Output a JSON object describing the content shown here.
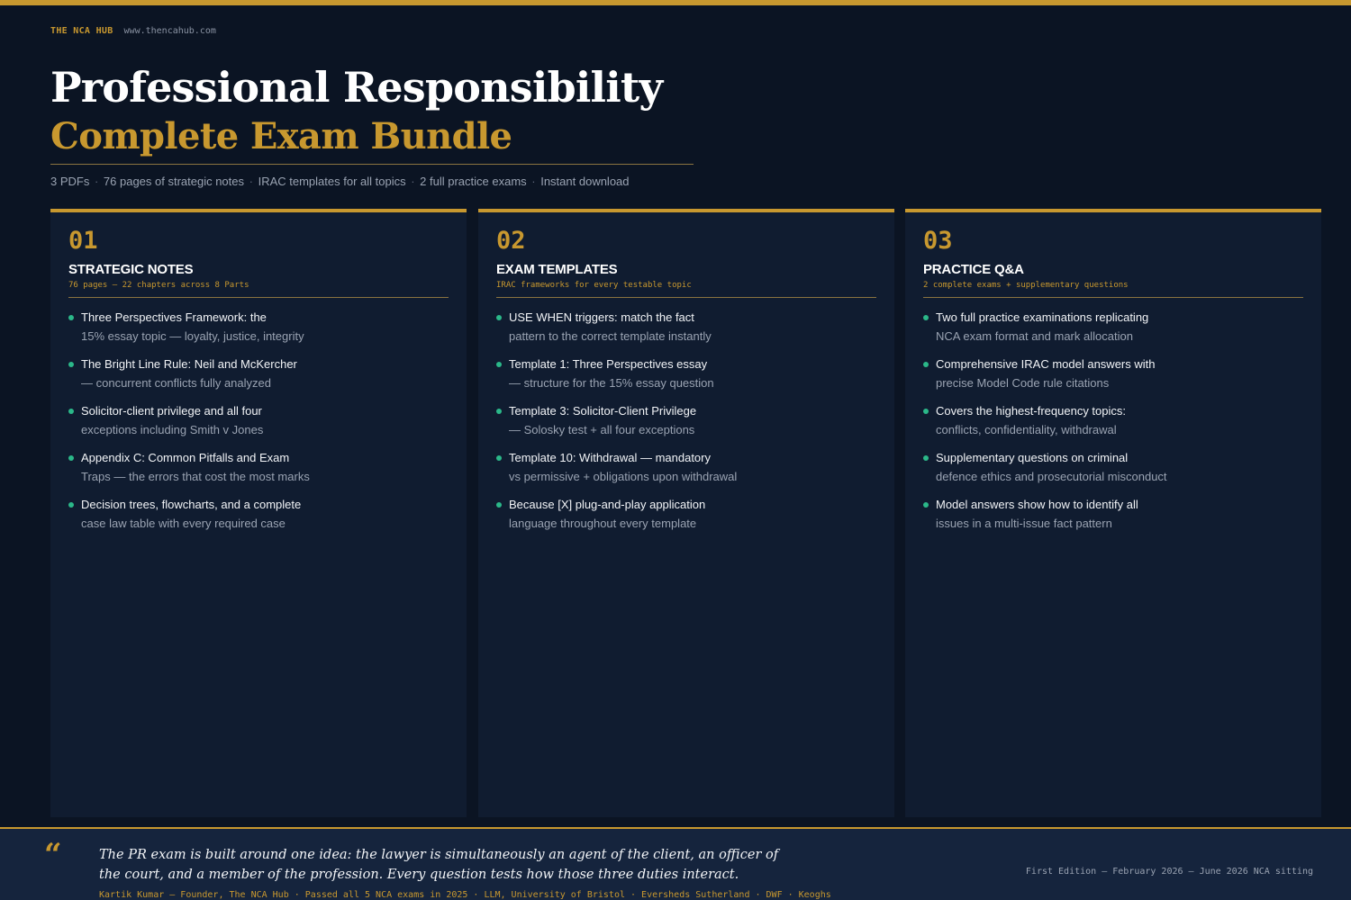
{
  "brand": {
    "name": "THE NCA HUB",
    "url": "www.thencahub.com"
  },
  "header": {
    "title": "Professional Responsibility",
    "subtitle": "Complete Exam Bundle",
    "meta": [
      "3 PDFs",
      "76 pages of strategic notes",
      "IRAC templates for all topics",
      "2 full practice exams",
      "Instant download"
    ],
    "meta_separator": "·"
  },
  "cards": [
    {
      "number": "01",
      "title": "STRATEGIC NOTES",
      "subtitle": "76 pages — 22 chapters across 8 Parts",
      "items": [
        {
          "line1": "Three Perspectives Framework: the",
          "line2": "15% essay topic — loyalty, justice, integrity"
        },
        {
          "line1": "The Bright Line Rule: Neil and McKercher",
          "line2": "— concurrent conflicts fully analyzed"
        },
        {
          "line1": "Solicitor-client privilege and all four",
          "line2": "exceptions including Smith v Jones"
        },
        {
          "line1": "Appendix C: Common Pitfalls and Exam",
          "line2": "Traps — the errors that cost the most marks"
        },
        {
          "line1": "Decision trees, flowcharts, and a complete",
          "line2": "case law table with every required case"
        }
      ]
    },
    {
      "number": "02",
      "title": "EXAM TEMPLATES",
      "subtitle": "IRAC frameworks for every testable topic",
      "items": [
        {
          "line1": "USE WHEN triggers: match the fact",
          "line2": "pattern to the correct template instantly"
        },
        {
          "line1": "Template 1: Three Perspectives essay",
          "line2": "— structure for the 15% essay question"
        },
        {
          "line1": "Template 3: Solicitor-Client Privilege",
          "line2": "— Solosky test + all four exceptions"
        },
        {
          "line1": "Template 10: Withdrawal — mandatory",
          "line2": "vs permissive + obligations upon withdrawal"
        },
        {
          "line1": "Because [X] plug-and-play application",
          "line2": "language throughout every template"
        }
      ]
    },
    {
      "number": "03",
      "title": "PRACTICE Q&A",
      "subtitle": "2 complete exams + supplementary questions",
      "items": [
        {
          "line1": "Two full practice examinations replicating",
          "line2": "NCA exam format and mark allocation"
        },
        {
          "line1": "Comprehensive IRAC model answers with",
          "line2": "precise Model Code rule citations"
        },
        {
          "line1": "Covers the highest-frequency topics:",
          "line2": "conflicts, confidentiality, withdrawal"
        },
        {
          "line1": "Supplementary questions on criminal",
          "line2": "defence ethics and prosecutorial misconduct"
        },
        {
          "line1": "Model answers show how to identify all",
          "line2": "issues in a multi-issue fact pattern"
        }
      ]
    }
  ],
  "footer": {
    "quote_mark": "“",
    "quote": "The PR exam is built around one idea: the lawyer is simultaneously an agent of the client, an officer of the court, and a member of the profession. Every question tests how those three duties interact.",
    "attribution": "Kartik Kumar  —  Founder, The NCA Hub  ·  Passed all 5 NCA exams in 2025  ·  LLM, University of Bristol  ·  Eversheds Sutherland · DWF · Keoghs",
    "edition": "First Edition  —  February 2026  —  June 2026 NCA sitting"
  },
  "colors": {
    "accent": "#c8982f",
    "bullet": "#2bb889",
    "background": "#0b1423",
    "card": "#101c30",
    "footer": "#15243d"
  }
}
